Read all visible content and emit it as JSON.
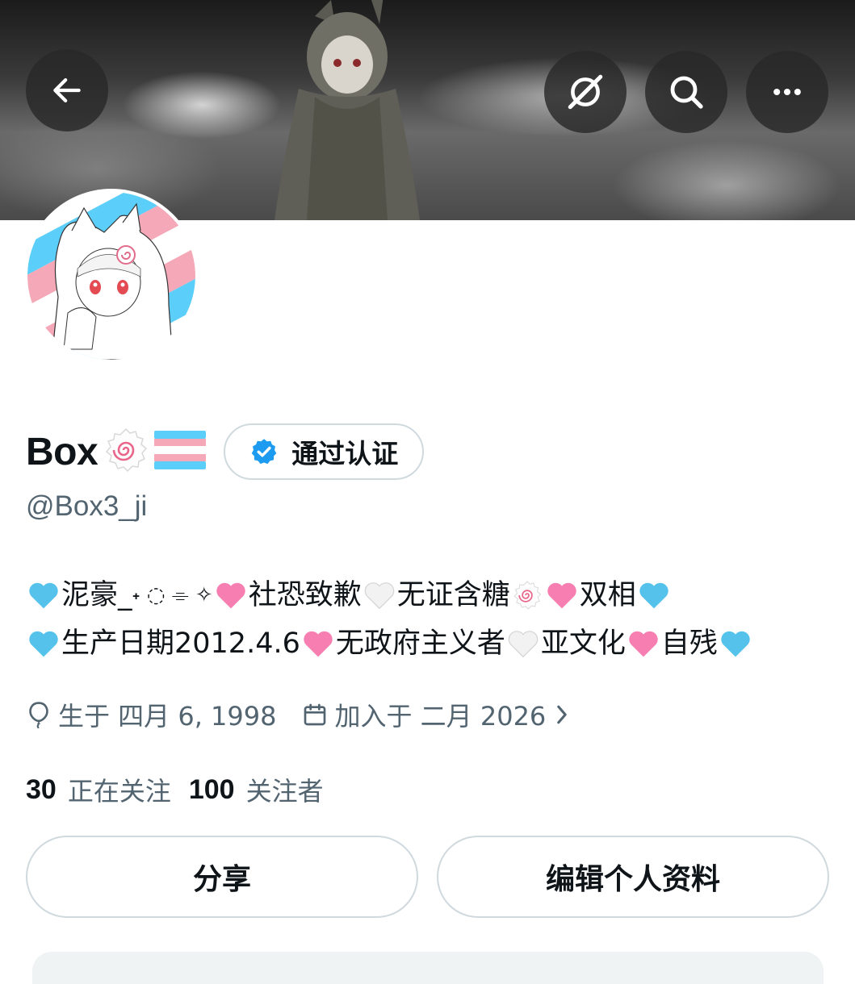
{
  "profile": {
    "display_name": "Box",
    "handle": "@Box3_ji",
    "verified_label": "通过认证",
    "bio_line1": {
      "seg1": "泥豪_",
      "seg1b": "˖ ◌ ⌯ ✧",
      "seg2": "社恐致歉",
      "seg3": "无证含糖",
      "seg4": "双相"
    },
    "bio_line2": {
      "seg1": "生产日期2012.4.6",
      "seg2": "无政府主义者",
      "seg3": "亚文化",
      "seg4": "自残"
    },
    "birth": "生于 四月 6, 1998",
    "joined": "加入于 二月 2026",
    "following_count": "30",
    "following_label": "正在关注",
    "followers_count": "100",
    "followers_label": "关注者"
  },
  "actions": {
    "share_label": "分享",
    "edit_label": "编辑个人资料"
  },
  "icons": {
    "back": "arrow-left-icon",
    "grok": "grok-icon",
    "search": "search-icon",
    "more": "more-icon",
    "verified": "verified-badge-icon",
    "birth": "balloon-icon",
    "joined": "calendar-icon",
    "chevron": "chevron-right-icon"
  },
  "colors": {
    "verified_blue": "#1d9bf0",
    "trans_blue": "#5bcefa",
    "trans_pink": "#f5a9b8",
    "muted_text": "#536471",
    "border": "#cfd9de"
  }
}
